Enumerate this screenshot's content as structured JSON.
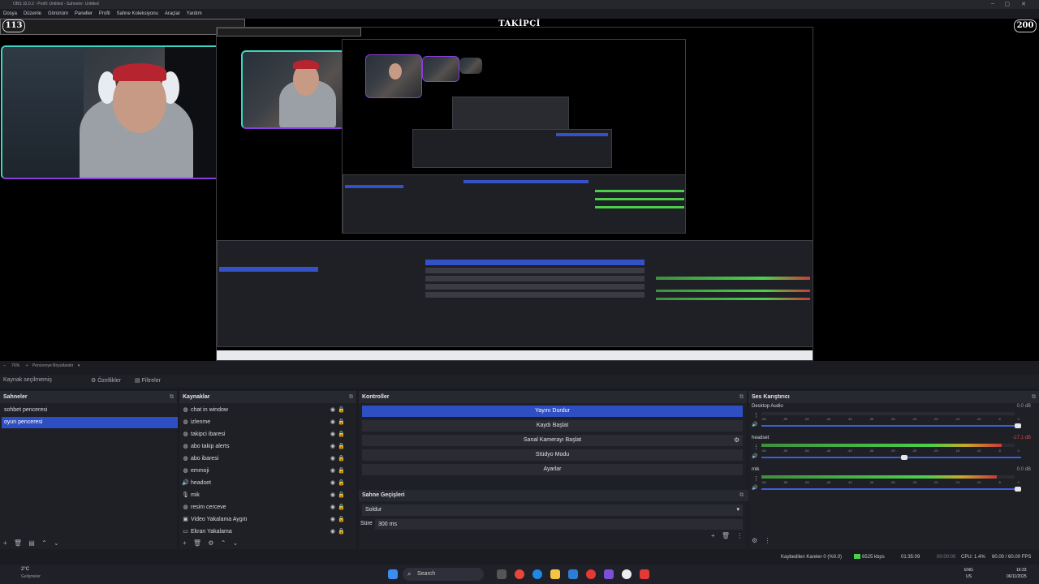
{
  "window": {
    "title": "OBS 32.0.2 - Profil: Untitled - Sahneler: Untitled"
  },
  "menu": [
    "Dosya",
    "Düzenle",
    "Görünüm",
    "Paneller",
    "Profil",
    "Sahne Koleksiyonu",
    "Araçlar",
    "Yardım"
  ],
  "overlay": {
    "left_count": "113",
    "title": "TAKİPÇİ",
    "right_count": "200"
  },
  "preview_status": {
    "zoom": "76%",
    "mode": "Pencereye Boyutlandır"
  },
  "toolbar": {
    "source_label": "Kaynak seçilmemiş",
    "properties": "Özellikler",
    "filters": "Filtreler"
  },
  "scenes": {
    "title": "Sahneler",
    "items": [
      "sohbet penceresi",
      "oyun penceresi"
    ],
    "active_index": 1
  },
  "sources": {
    "title": "Kaynaklar",
    "items": [
      {
        "name": "chat in window",
        "icon": "globe-icon"
      },
      {
        "name": "izlenme",
        "icon": "globe-icon"
      },
      {
        "name": "takipci ibaresi",
        "icon": "globe-icon"
      },
      {
        "name": "abo takip alerts",
        "icon": "globe-icon"
      },
      {
        "name": "abo ibaresi",
        "icon": "globe-icon"
      },
      {
        "name": "emmoji",
        "icon": "globe-icon"
      },
      {
        "name": "headset",
        "icon": "speaker-icon"
      },
      {
        "name": "mik",
        "icon": "mic-icon"
      },
      {
        "name": "resim cerceve",
        "icon": "globe-icon"
      },
      {
        "name": "Video Yakalama Aygıtı",
        "icon": "camera-icon"
      },
      {
        "name": "Ekran Yakalama",
        "icon": "monitor-icon"
      }
    ]
  },
  "controls": {
    "title": "Kontroller",
    "buttons": [
      "Yayını Durdur",
      "Kaydı Başlat",
      "Sanal Kamerayı Başlat",
      "Stüdyo Modu",
      "Ayarlar"
    ]
  },
  "transitions": {
    "title": "Sahne Geçişleri",
    "selected": "Soldur",
    "duration_label": "Süre",
    "duration_value": "300 ms"
  },
  "mixer": {
    "title": "Ses Karıştırıcı",
    "channels": [
      {
        "name": "Desktop Audio",
        "db": "0.0 dB",
        "level": 0.0,
        "volume": 1.0
      },
      {
        "name": "headset",
        "db": "-17.1 dB",
        "level": 0.95,
        "volume": 0.55
      },
      {
        "name": "mik",
        "db": "0.0 dB",
        "level": 0.93,
        "volume": 1.0
      }
    ],
    "ticks": [
      "-60",
      "-55",
      "-50",
      "-45",
      "-40",
      "-35",
      "-30",
      "-25",
      "-20",
      "-15",
      "-10",
      "-5",
      "0"
    ]
  },
  "statusbar": {
    "dropped": "Kaybedilen Kareler 0 (%0.0)",
    "bitrate": "6525 kbps",
    "stream_time": "01:35:09",
    "rec_time": "00:00:00",
    "cpu": "CPU: 1.4%",
    "fps": "60.00 / 60.00 FPS"
  },
  "taskbar": {
    "weather": "2°C",
    "weather_sub": "Gelişmeler",
    "search": "Search",
    "lang": "ENG",
    "region": "US",
    "time": "16:33",
    "date": "06/11/2025"
  }
}
